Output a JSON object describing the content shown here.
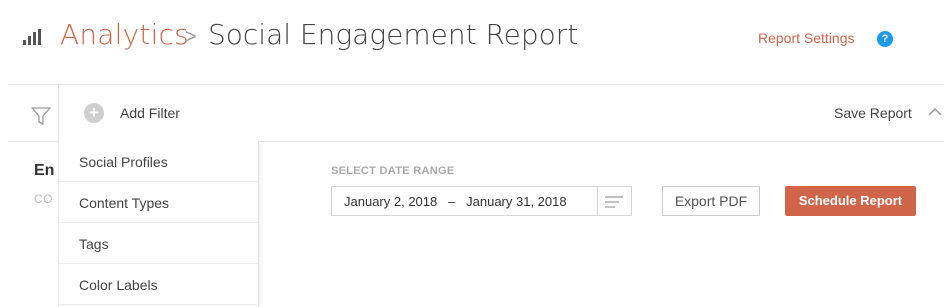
{
  "header": {
    "breadcrumb_root": "Analytics",
    "breadcrumb_separator": ">",
    "page_title": "Social Engagement Report",
    "settings_link": "Report Settings",
    "help_label": "?"
  },
  "filter_bar": {
    "add_filter_label": "Add Filter",
    "save_report_label": "Save Report"
  },
  "filter_menu": {
    "items": [
      {
        "label": "Social Profiles"
      },
      {
        "label": "Content Types"
      },
      {
        "label": "Tags"
      },
      {
        "label": "Color Labels"
      }
    ]
  },
  "section": {
    "title": "En",
    "subtitle": "CO"
  },
  "date_picker": {
    "label": "SELECT DATE RANGE",
    "value": "January 2, 2018   –   January 31, 2018"
  },
  "actions": {
    "export_label": "Export PDF",
    "schedule_label": "Schedule Report"
  },
  "colors": {
    "accent": "#d0654a",
    "help": "#1b9bf0"
  },
  "icons": [
    "bar-chart-icon",
    "chevron-right-icon",
    "help-icon",
    "funnel-icon",
    "plus-circle-icon",
    "chevron-up-icon",
    "lines-icon"
  ]
}
